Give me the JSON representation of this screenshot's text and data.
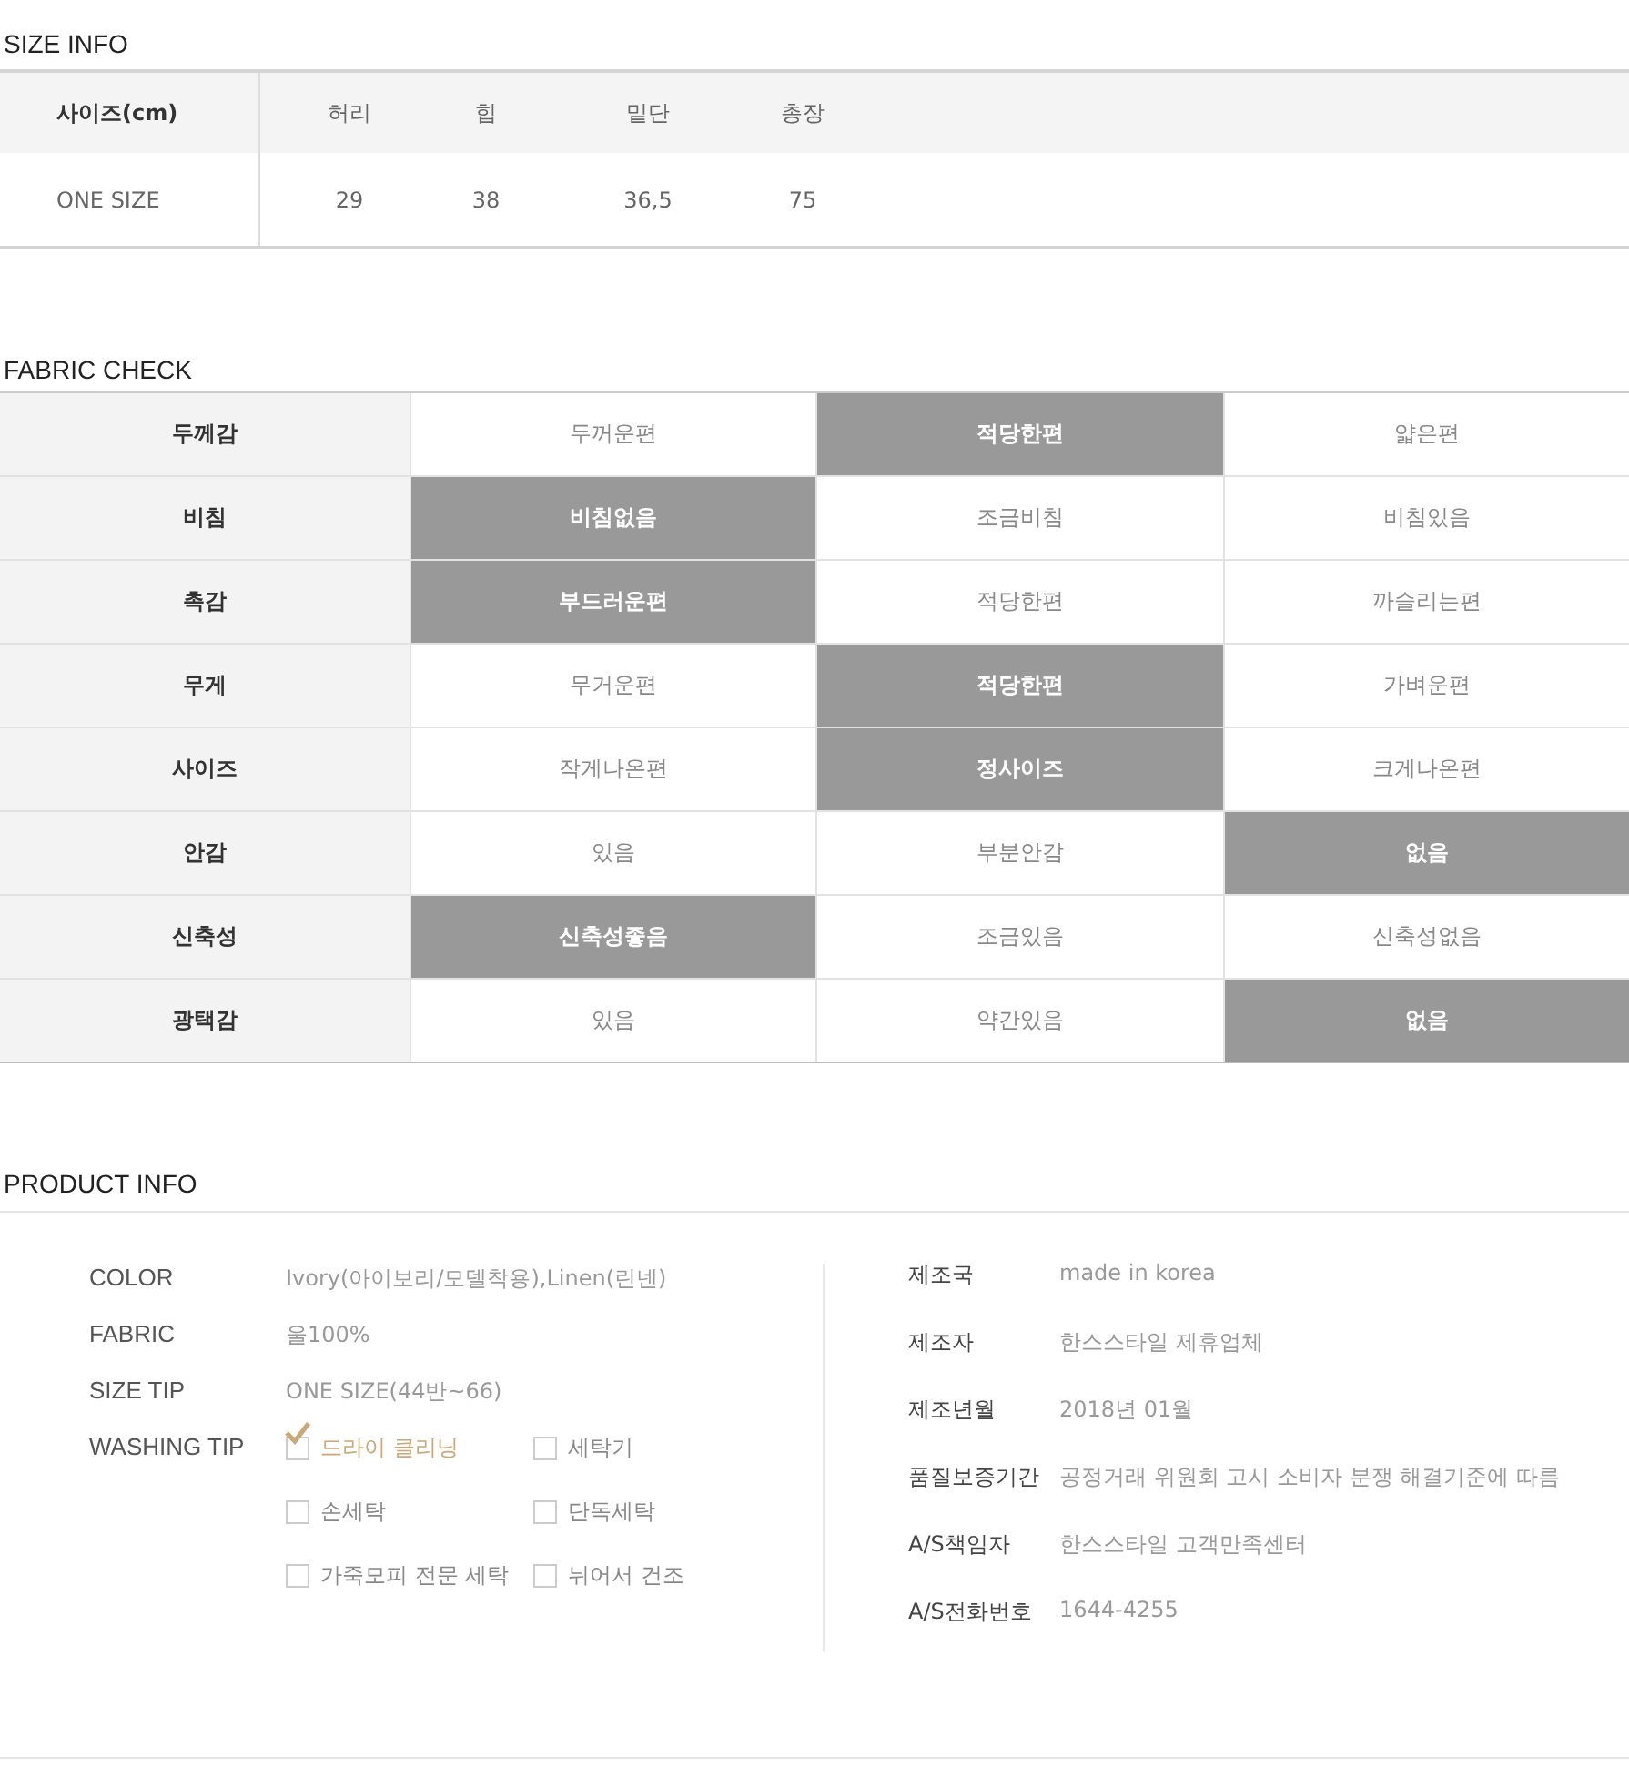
{
  "size_info": {
    "title": "SIZE INFO",
    "columns": [
      "사이즈(cm)",
      "허리",
      "힙",
      "밑단",
      "총장"
    ],
    "rows": [
      {
        "cells": [
          "ONE SIZE",
          "29",
          "38",
          "36,5",
          "75"
        ]
      }
    ]
  },
  "fabric_check": {
    "title": "FABRIC CHECK",
    "rows": [
      {
        "label": "두께감",
        "options": [
          {
            "text": "두꺼운편",
            "selected": false
          },
          {
            "text": "적당한편",
            "selected": true
          },
          {
            "text": "얇은편",
            "selected": false
          }
        ]
      },
      {
        "label": "비침",
        "options": [
          {
            "text": "비침없음",
            "selected": true
          },
          {
            "text": "조금비침",
            "selected": false
          },
          {
            "text": "비침있음",
            "selected": false
          }
        ]
      },
      {
        "label": "촉감",
        "options": [
          {
            "text": "부드러운편",
            "selected": true
          },
          {
            "text": "적당한편",
            "selected": false
          },
          {
            "text": "까슬리는편",
            "selected": false
          }
        ]
      },
      {
        "label": "무게",
        "options": [
          {
            "text": "무거운편",
            "selected": false
          },
          {
            "text": "적당한편",
            "selected": true
          },
          {
            "text": "가벼운편",
            "selected": false
          }
        ]
      },
      {
        "label": "사이즈",
        "options": [
          {
            "text": "작게나온편",
            "selected": false
          },
          {
            "text": "정사이즈",
            "selected": true
          },
          {
            "text": "크게나온편",
            "selected": false
          }
        ]
      },
      {
        "label": "안감",
        "options": [
          {
            "text": "있음",
            "selected": false
          },
          {
            "text": "부분안감",
            "selected": false
          },
          {
            "text": "없음",
            "selected": true
          }
        ]
      },
      {
        "label": "신축성",
        "options": [
          {
            "text": "신축성좋음",
            "selected": true
          },
          {
            "text": "조금있음",
            "selected": false
          },
          {
            "text": "신축성없음",
            "selected": false
          }
        ]
      },
      {
        "label": "광택감",
        "options": [
          {
            "text": "있음",
            "selected": false
          },
          {
            "text": "약간있음",
            "selected": false
          },
          {
            "text": "없음",
            "selected": true
          }
        ]
      }
    ]
  },
  "product_info": {
    "title": "PRODUCT INFO",
    "left": [
      {
        "label": "COLOR",
        "value": "Ivory(아이보리/모델착용),Linen(린넨)"
      },
      {
        "label": "FABRIC",
        "value": "울100%"
      },
      {
        "label": "SIZE TIP",
        "value": "ONE SIZE(44반~66)"
      }
    ],
    "washing_tip": {
      "label": "WASHING TIP",
      "options": [
        {
          "text": "드라이 클리닝",
          "checked": true
        },
        {
          "text": "세탁기",
          "checked": false
        },
        {
          "text": "손세탁",
          "checked": false
        },
        {
          "text": "단독세탁",
          "checked": false
        },
        {
          "text": "가죽모피 전문 세탁",
          "checked": false
        },
        {
          "text": "뉘어서 건조",
          "checked": false
        }
      ]
    },
    "right": [
      {
        "label": "제조국",
        "value": "made in korea"
      },
      {
        "label": "제조자",
        "value": "한스스타일 제휴업체"
      },
      {
        "label": "제조년월",
        "value": "2018년 01월"
      },
      {
        "label": "품질보증기간",
        "value": "공정거래 위원회 고시 소비자 분쟁 해결기준에 따름"
      },
      {
        "label": "A/S책임자",
        "value": "한스스타일 고객만족센터"
      },
      {
        "label": "A/S전화번호",
        "value": "1644-4255"
      }
    ]
  }
}
